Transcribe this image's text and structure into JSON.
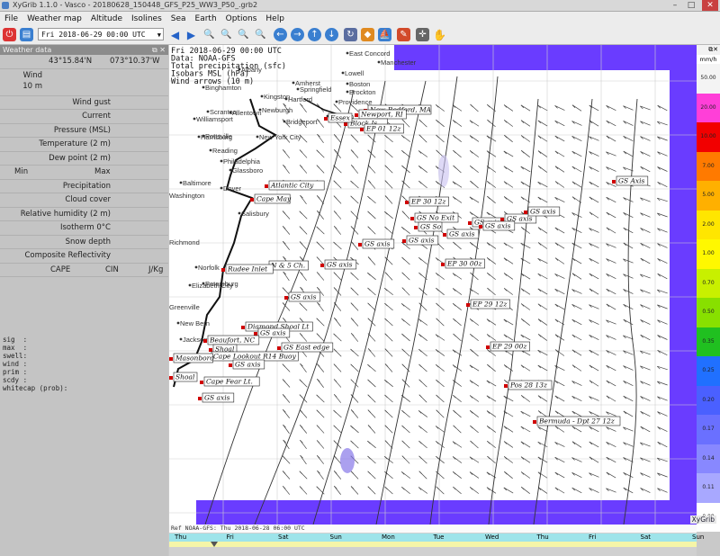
{
  "window": {
    "title": "XyGrib 1.1.0 - Vasco - 20180628_150448_GFS_P25_WW3_P50_.grb2",
    "min": "–",
    "max": "□",
    "close": "✕"
  },
  "menu": [
    "File",
    "Weather map",
    "Altitude",
    "Isolines",
    "Sea",
    "Earth",
    "Options",
    "Help"
  ],
  "toolbar": {
    "date": "Fri 2018-06-29 00:00 UTC"
  },
  "panel": {
    "title": "Weather data",
    "lat": "43°15.84'N",
    "lon": "073°10.37'W",
    "wind_label": "Wind",
    "wind_sub": "10 m",
    "rows": [
      "Wind gust",
      "Current",
      "Pressure (MSL)",
      "Temperature (2 m)",
      "Dew point (2 m)"
    ],
    "min_label": "Min",
    "max_label": "Max",
    "rows2": [
      "Precipitation",
      "Cloud cover",
      "Relative humidity (2 m)",
      "Isotherm 0°C",
      "Snow depth",
      "Composite Reflectivity"
    ],
    "cape": "CAPE",
    "cin": "CIN",
    "jkg": "J/Kg",
    "point_info": "sig  :\nmax  :\nswell:\nwind :\nprim :\nscdy :\nwhitecap (prob):"
  },
  "map_header": [
    "Fri 2018-06-29 00:00 UTC",
    "Data: NOAA-GFS",
    "Total precipitation (sfc)",
    "Isobars MSL (hPa)",
    "Wind arrows (10 m)"
  ],
  "cities": [
    {
      "n": "East Concord"
    },
    {
      "n": "Manchester"
    },
    {
      "n": "Lowell"
    },
    {
      "n": "Amherst"
    },
    {
      "n": "Boston"
    },
    {
      "n": "Springfield"
    },
    {
      "n": "Brockton"
    },
    {
      "n": "Hartford"
    },
    {
      "n": "Providence"
    },
    {
      "n": "Norwich"
    },
    {
      "n": "New York City"
    },
    {
      "n": "Bridgeport"
    },
    {
      "n": "Newburgh"
    },
    {
      "n": "Kingston"
    },
    {
      "n": "Albany"
    },
    {
      "n": "Binghamton"
    },
    {
      "n": "Scranton"
    },
    {
      "n": "Allentown"
    },
    {
      "n": "Philadelphia"
    },
    {
      "n": "Reading"
    },
    {
      "n": "Harrisburg"
    },
    {
      "n": "Baltimore"
    },
    {
      "n": "Washington"
    },
    {
      "n": "Dover"
    },
    {
      "n": "Richmond"
    },
    {
      "n": "Norfolk"
    },
    {
      "n": "Elizabeth City"
    },
    {
      "n": "Greenville"
    },
    {
      "n": "New Bern"
    },
    {
      "n": "Jacksonville"
    },
    {
      "n": "Petersburg"
    },
    {
      "n": "Salisbury"
    },
    {
      "n": "Glassboro"
    },
    {
      "n": "Williamsport"
    },
    {
      "n": "Pottsville"
    }
  ],
  "markers": [
    {
      "n": "New Bedford, MA"
    },
    {
      "n": "Newport, RI"
    },
    {
      "n": "Block Is."
    },
    {
      "n": "EP 01 12z"
    },
    {
      "n": "Essex"
    },
    {
      "n": "Atlantic City"
    },
    {
      "n": "Cape May"
    },
    {
      "n": "GS Axis"
    },
    {
      "n": "EP 30 12z"
    },
    {
      "n": "GS No Exit"
    },
    {
      "n": "GS So"
    },
    {
      "n": "GS axis"
    },
    {
      "n": "GS axis"
    },
    {
      "n": "GS axis"
    },
    {
      "n": "GS axis"
    },
    {
      "n": "GS axis"
    },
    {
      "n": "GS axis"
    },
    {
      "n": "EP 30 00z"
    },
    {
      "n": "N & 5 Ch."
    },
    {
      "n": "Rudee Inlet"
    },
    {
      "n": "GS axis"
    },
    {
      "n": "GS axis"
    },
    {
      "n": "EP 29 12z"
    },
    {
      "n": "Diamond Shoal Lt"
    },
    {
      "n": "GS axis"
    },
    {
      "n": "Beaufort, NC"
    },
    {
      "n": "Shoal"
    },
    {
      "n": "Cape Lookout R14 Buoy"
    },
    {
      "n": "GS East edge"
    },
    {
      "n": "EP 29 00z"
    },
    {
      "n": "Masonboro"
    },
    {
      "n": "GS axis"
    },
    {
      "n": "Shoal"
    },
    {
      "n": "Cape Fear Lt."
    },
    {
      "n": "GS axis"
    },
    {
      "n": "Pos 28 13z"
    },
    {
      "n": "Bermuda - Dpt 27 12z"
    },
    {
      "n": "GS axis"
    }
  ],
  "legend": {
    "unit": "mm/h",
    "values": [
      "50.00",
      "20.00",
      "10.00",
      "7.00",
      "5.00",
      "2.00",
      "1.00",
      "0.70",
      "0.50",
      "0.35",
      "0.25",
      "0.20",
      "0.17",
      "0.14",
      "0.11",
      "0.08"
    ],
    "colors": [
      "#f4f4f4",
      "#ff3fd8",
      "#f20000",
      "#ff7a00",
      "#ffb000",
      "#ffe600",
      "#fff800",
      "#c8f000",
      "#88e000",
      "#20c020",
      "#2070ff",
      "#4a60ff",
      "#6a70ff",
      "#8888ff",
      "#a8a8ff",
      "#ffffff"
    ]
  },
  "timebar": {
    "ref": "Ref NOAA-GFS: Thu 2018-06-28 06:00 UTC",
    "days": [
      "Thu",
      "Fri",
      "Sat",
      "Sun",
      "Mon",
      "Tue",
      "Wed",
      "Thu",
      "Fri",
      "Sat",
      "Sun"
    ]
  },
  "brand": "XyGrib",
  "colors": {
    "ocean": "#ffffff",
    "land": "#ffffff",
    "border": "#6a3cff",
    "coast": "#111111"
  }
}
